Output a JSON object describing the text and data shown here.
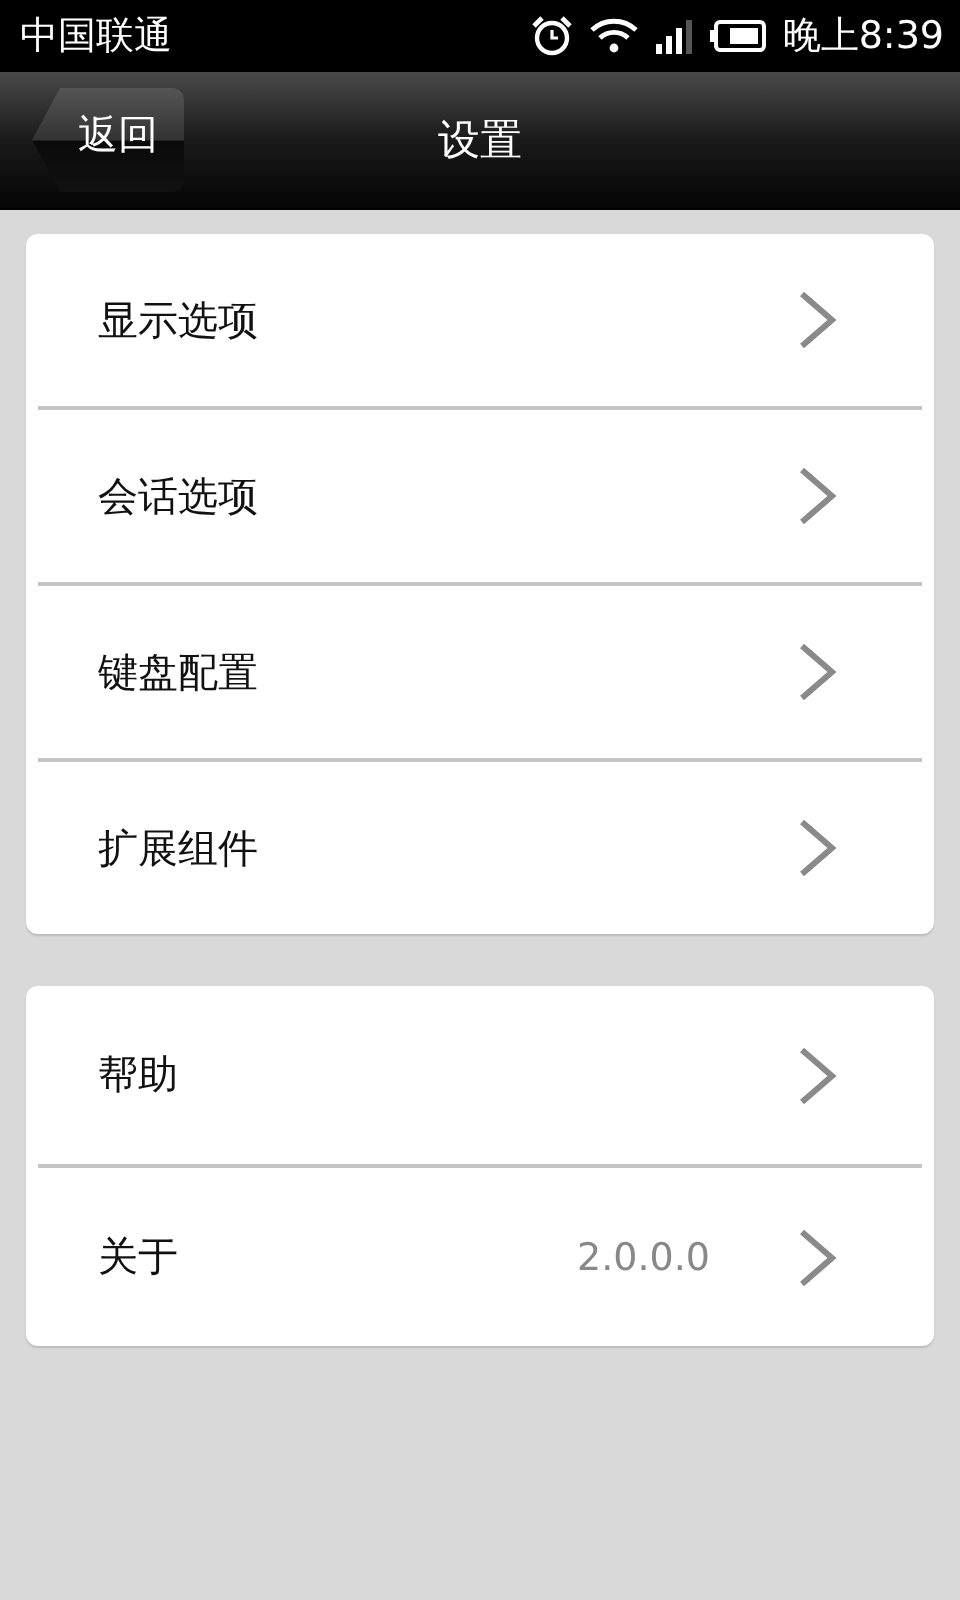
{
  "status_bar": {
    "carrier": "中国联通",
    "time": "晚上8:39"
  },
  "header": {
    "back": "返回",
    "title": "设置"
  },
  "groups": [
    {
      "items": [
        {
          "label": "显示选项"
        },
        {
          "label": "会话选项"
        },
        {
          "label": "键盘配置"
        },
        {
          "label": "扩展组件"
        }
      ]
    },
    {
      "items": [
        {
          "label": "帮助"
        },
        {
          "label": "关于",
          "value": "2.0.0.0"
        }
      ]
    }
  ]
}
